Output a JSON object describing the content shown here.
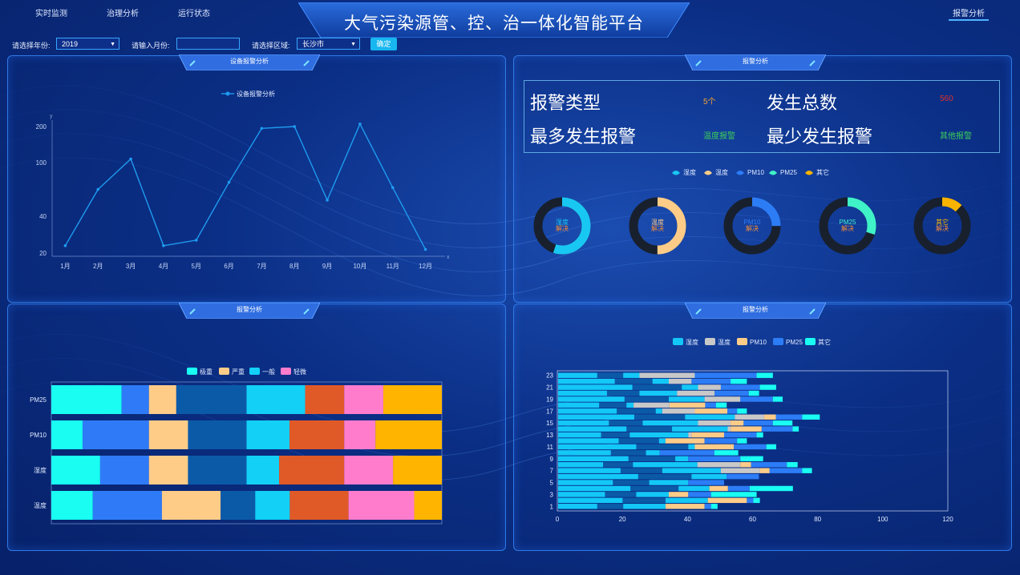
{
  "nav": {
    "tabs": [
      "实时监测",
      "治理分析",
      "运行状态"
    ],
    "title": "大气污染源管、控、治一体化智能平台",
    "alarm_tab": "报警分析"
  },
  "filters": {
    "year_label": "请选择年份:",
    "year_value": "2019",
    "month_label": "请输入月份:",
    "month_value": "",
    "region_label": "请选择区域:",
    "region_value": "长沙市",
    "confirm_label": "确定"
  },
  "panels": {
    "top_left_title": "设备报警分析",
    "top_right_title": "报警分析",
    "bottom_left_title": "报警分析",
    "bottom_right_title": "报警分析"
  },
  "summary": {
    "type_label": "报警类型",
    "type_value": "5个",
    "total_label": "发生总数",
    "total_value": "560",
    "most_label": "最多发生报警",
    "most_value": "温度报警",
    "least_label": "最少发生报警",
    "least_value": "其他报警"
  },
  "colors": {
    "line": "#1e9bf0",
    "red": "#e0302c",
    "green": "#3ccf5a",
    "orange": "#f0a030"
  },
  "chart_data": [
    {
      "type": "line",
      "legend": "设备报警分析",
      "xlabel": "x",
      "ylabel": "y",
      "categories": [
        "1月",
        "2月",
        "3月",
        "4月",
        "5月",
        "6月",
        "7月",
        "8月",
        "9月",
        "10月",
        "11月",
        "12月"
      ],
      "y_ticks": [
        "20",
        "40",
        "100",
        "200"
      ],
      "values": [
        24,
        70,
        110,
        24,
        27,
        78,
        195,
        200,
        58,
        208,
        72,
        22
      ]
    },
    {
      "type": "pie",
      "legend": [
        "湿度",
        "温度",
        "PM10",
        "PM25",
        "其它"
      ],
      "rings": [
        {
          "name": "湿度",
          "label": "湿度",
          "sub": "解决",
          "solved": 0.55,
          "color": "#19c8f2"
        },
        {
          "name": "温度",
          "label": "温度",
          "sub": "解决",
          "solved": 0.5,
          "color": "#ffcc88"
        },
        {
          "name": "PM10",
          "label": "PM10",
          "sub": "解决",
          "solved": 0.25,
          "color": "#2c7cf6"
        },
        {
          "name": "PM25",
          "label": "PM25",
          "sub": "解决",
          "solved": 0.3,
          "color": "#3ff2c8"
        },
        {
          "name": "其它",
          "label": "其它",
          "sub": "解决",
          "solved": 0.12,
          "color": "#f9b300"
        }
      ]
    },
    {
      "type": "bar",
      "orientation": "horizontal-stacked",
      "legend": [
        "极重",
        "严重",
        "一般",
        "轻微"
      ],
      "categories": [
        "温度",
        "湿度",
        "PM10",
        "PM25"
      ],
      "segment_colors": [
        "#19fdf2",
        "#2f7bf7",
        "#ffcc88",
        "#0a5aa8",
        "#13d0f7",
        "#e05a28",
        "#ff7ccd",
        "#ffb400"
      ],
      "rows": [
        [
          12,
          20,
          17,
          10,
          10,
          17,
          19,
          8
        ],
        [
          15,
          15,
          12,
          18,
          10,
          20,
          15,
          15
        ],
        [
          8,
          17,
          10,
          15,
          11,
          14,
          8,
          17
        ],
        [
          18,
          7,
          7,
          18,
          15,
          10,
          10,
          15
        ]
      ]
    },
    {
      "type": "bar",
      "orientation": "horizontal-stacked",
      "legend": [
        "湿度",
        "温度",
        "PM10",
        "PM25",
        "其它"
      ],
      "x_ticks": [
        0,
        20,
        40,
        60,
        80,
        100,
        120
      ],
      "y_labels": [
        "1",
        "3",
        "5",
        "7",
        "9",
        "11",
        "13",
        "15",
        "17",
        "19",
        "21",
        "23"
      ],
      "rows": [
        [
          13,
          0,
          12,
          2,
          2
        ],
        [
          10,
          0,
          6,
          7,
          14
        ],
        [
          12,
          0,
          0,
          11,
          0
        ],
        [
          18,
          12,
          3,
          10,
          3
        ],
        [
          4,
          0,
          0,
          16,
          7
        ],
        [
          2,
          0,
          12,
          10,
          3
        ],
        [
          18,
          1,
          10,
          10,
          2
        ],
        [
          17,
          10,
          4,
          9,
          6
        ],
        [
          2,
          10,
          10,
          3,
          3
        ],
        [
          11,
          11,
          0,
          10,
          3
        ],
        [
          5,
          7,
          0,
          12,
          5
        ],
        [
          5,
          17,
          0,
          19,
          5
        ]
      ]
    }
  ]
}
